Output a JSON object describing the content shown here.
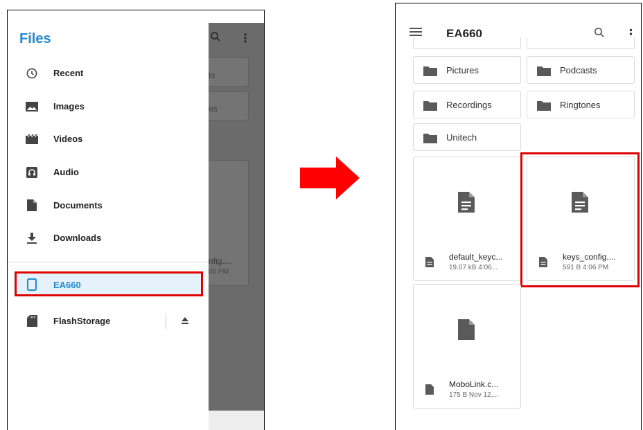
{
  "left_screen": {
    "drawer": {
      "title": "Files",
      "items": [
        {
          "label": "Recent",
          "icon": "clock-icon"
        },
        {
          "label": "Images",
          "icon": "image-icon"
        },
        {
          "label": "Videos",
          "icon": "movie-icon"
        },
        {
          "label": "Audio",
          "icon": "headphones-icon"
        },
        {
          "label": "Documents",
          "icon": "document-icon"
        },
        {
          "label": "Downloads",
          "icon": "download-icon"
        }
      ],
      "roots": [
        {
          "label": "EA660",
          "icon": "phone-icon",
          "selected": true
        },
        {
          "label": "FlashStorage",
          "icon": "sd-card-icon",
          "action_icon": "eject-icon"
        }
      ]
    },
    "background": {
      "tile1_text": "ts",
      "tile2_text": "es",
      "file_name": "nfig....",
      "file_meta": "06 PM"
    }
  },
  "right_screen": {
    "appbar": {
      "title": "EA660"
    },
    "folders": [
      "Pictures",
      "Podcasts",
      "Recordings",
      "Ringtones",
      "Unitech"
    ],
    "files": [
      {
        "name": "default_keyc...",
        "meta": "19.07 kB 4:06..."
      },
      {
        "name": "keys_config....",
        "meta": "591 B 4:06 PM"
      },
      {
        "name": "MoboLink.c...",
        "meta": "175 B Nov 12,..."
      }
    ]
  },
  "colors": {
    "accent": "#2188d4",
    "highlight": "#e00000",
    "selected_bg": "#e5f1fb",
    "icon": "#555555"
  }
}
